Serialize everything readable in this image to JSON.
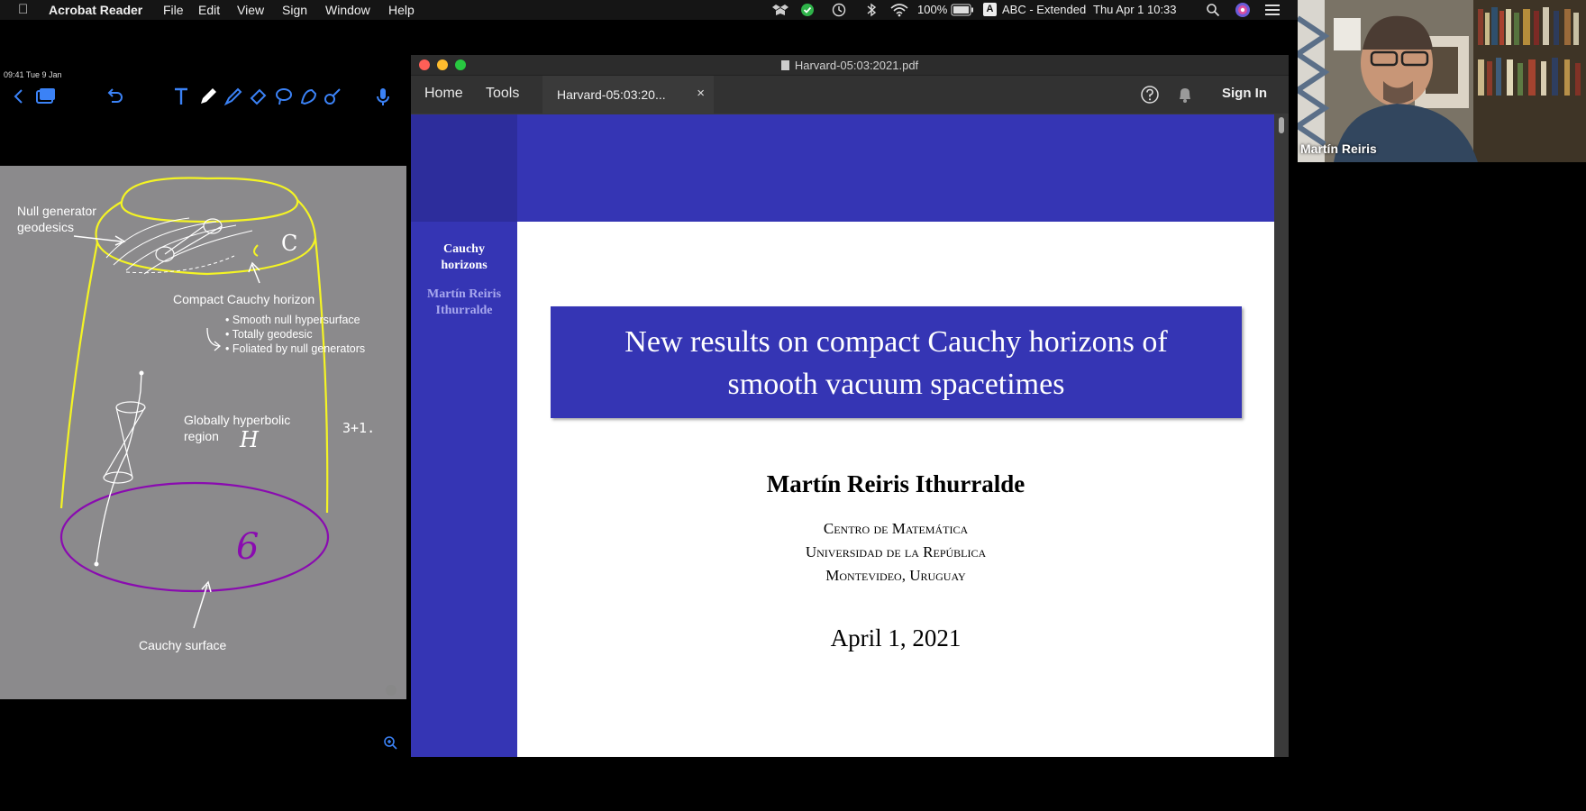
{
  "menubar": {
    "app_name": "Acrobat Reader",
    "menus": [
      "File",
      "Edit",
      "View",
      "Sign",
      "Window",
      "Help"
    ],
    "battery": "100%",
    "input_source": "ABC - Extended",
    "datetime": "Thu Apr 1  10:33"
  },
  "notes": {
    "status_time": "09:41  Tue 9 Jan",
    "labels": {
      "null_generator": "Null generator",
      "geodesics": "geodesics",
      "compact_horizon": "Compact Cauchy horizon",
      "bullet1": "Smooth null hypersurface",
      "bullet2": "Totally geodesic",
      "bullet3": "Foliated by null generators",
      "globally_hyperbolic": "Globally hyperbolic",
      "region": "region",
      "cauchy_surface": "Cauchy surface",
      "handwritten_c": "C",
      "handwritten_h": "H",
      "handwritten_dim": "3+1.",
      "handwritten_sigma": "6"
    }
  },
  "acrobat": {
    "window_title": "Harvard-05:03:2021.pdf",
    "nav_home": "Home",
    "nav_tools": "Tools",
    "tab_label": "Harvard-05:03:20...",
    "tab_close": "×",
    "sign_in": "Sign In"
  },
  "slide": {
    "sidebar_title_1": "Cauchy",
    "sidebar_title_2": "horizons",
    "sidebar_author_1": "Martín Reiris",
    "sidebar_author_2": "Ithurralde",
    "title_line1": "New results on compact Cauchy horizons of",
    "title_line2": "smooth vacuum spacetimes",
    "author": "Martín Reiris Ithurralde",
    "inst1": "Centro de Matemática",
    "inst2": "Universidad de la República",
    "inst3": "Montevideo, Uruguay",
    "date": "April 1, 2021"
  },
  "webcam": {
    "participant_name": "Martín Reiris"
  }
}
